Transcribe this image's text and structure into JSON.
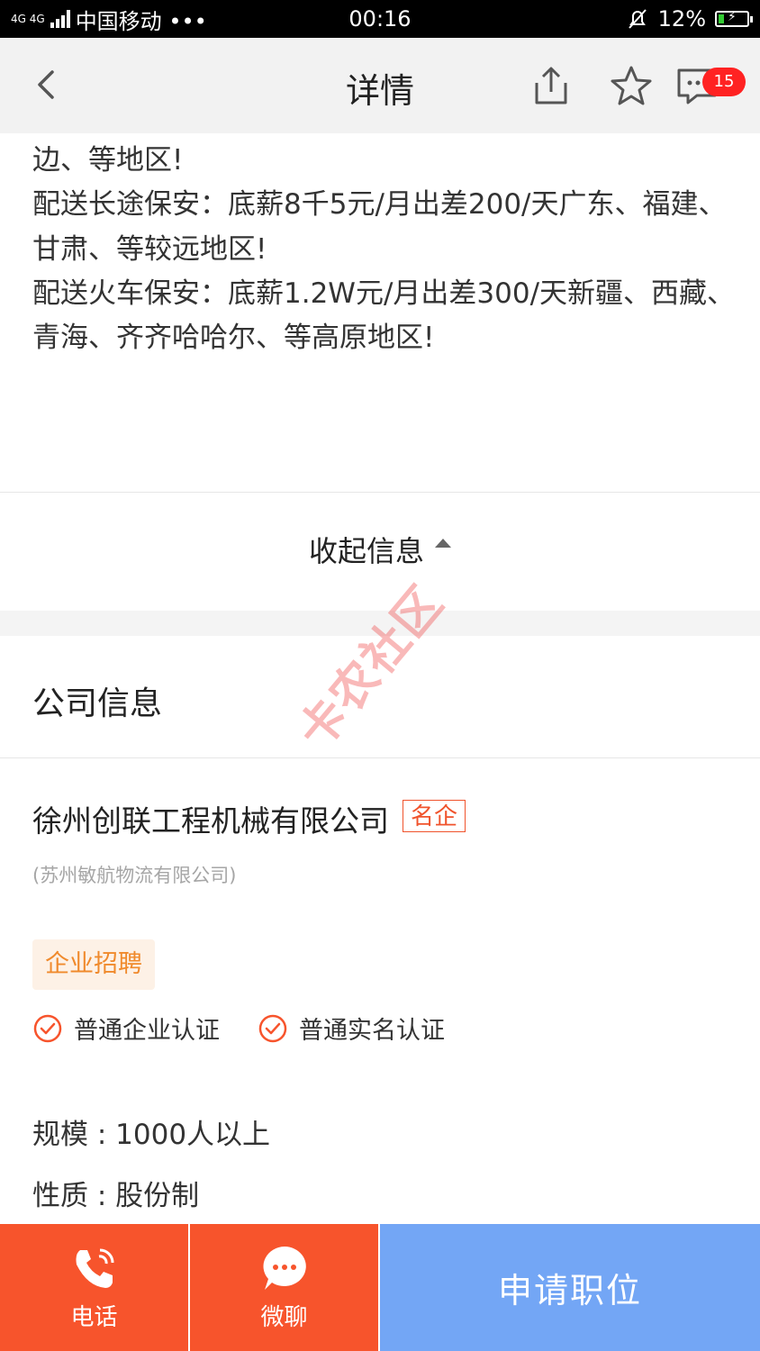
{
  "status_bar": {
    "network": "4G 4G",
    "carrier": "中国移动 •••",
    "time": "00:16",
    "battery": "12%"
  },
  "header": {
    "title": "详情",
    "message_count": "15"
  },
  "description": {
    "lines": [
      "边、等地区!",
      "配送长途保安：底薪8千5元/月出差200/天广东、福建、甘肃、等较远地区!",
      "配送火车保安：底薪1.2W元/月出差300/天新疆、西藏、青海、齐齐哈哈尔、等高原地区!"
    ]
  },
  "collapse_label": "收起信息",
  "company": {
    "section_title": "公司信息",
    "name": "徐州创联工程机械有限公司",
    "famous_tag": "名企",
    "alias": "(苏州敏航物流有限公司)",
    "recruit_tag": "企业招聘",
    "certifications": [
      "普通企业认证",
      "普通实名认证"
    ],
    "scale_label": "规模",
    "scale_value": "1000人以上",
    "nature_label": "性质",
    "nature_value": "股份制"
  },
  "watermark": "卡农社区",
  "bottom_bar": {
    "phone_label": "电话",
    "chat_label": "微聊",
    "apply_label": "申请职位"
  },
  "colors": {
    "accent": "#f7542c",
    "apply": "#73a6f5",
    "badge": "#ff2222",
    "tag_bg": "#fdf1e6",
    "tag_text": "#f08a2c"
  }
}
